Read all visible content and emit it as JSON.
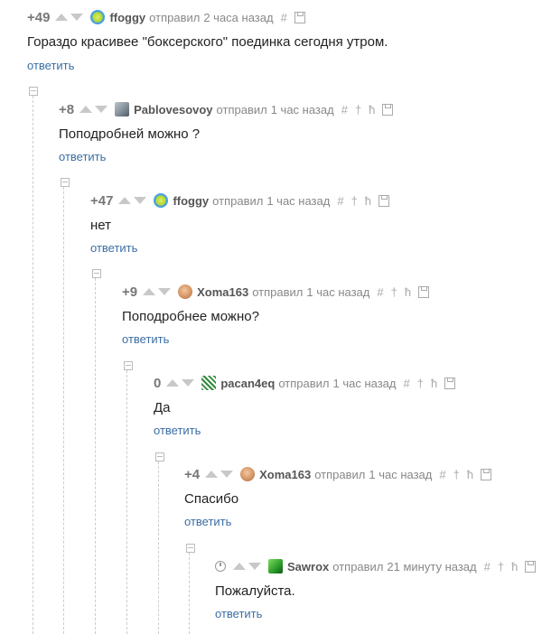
{
  "common": {
    "action": "отправил",
    "reply": "ответить",
    "hash": "#",
    "pin": "†",
    "branch": "ћ"
  },
  "comments": [
    {
      "rating": "+49",
      "author": "ffoggy",
      "time": "2 часа назад",
      "text": "Гораздо красивее \"боксерского\" поединка сегодня утром."
    },
    {
      "rating": "+8",
      "author": "Pablovesovoy",
      "time": "1 час назад",
      "text": "Поподробней можно ?"
    },
    {
      "rating": "+47",
      "author": "ffoggy",
      "time": "1 час назад",
      "text": "нет"
    },
    {
      "rating": "+9",
      "author": "Xoma163",
      "time": "1 час назад",
      "text": "Поподробнее можно?"
    },
    {
      "rating": "0",
      "author": "pacan4eq",
      "time": "1 час назад",
      "text": "Да"
    },
    {
      "rating": "+4",
      "author": "Xoma163",
      "time": "1 час назад",
      "text": "Спасибо"
    },
    {
      "rating": "",
      "author": "Sawrox",
      "time": "21 минуту назад",
      "text": "Пожалуйста."
    }
  ]
}
